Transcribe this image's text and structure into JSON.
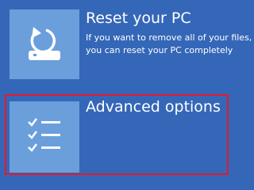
{
  "screen": {
    "background_color": "#3567b8",
    "selection_border_color": "#e11a2b",
    "icon_tile_color": "#6a9fdc"
  },
  "options": [
    {
      "id": "reset",
      "title": "Reset your PC",
      "description_lines": [
        "If you want to remove all of your files,",
        "you can reset your PC completely"
      ],
      "icon": "reset-pc-icon"
    },
    {
      "id": "advanced",
      "title": "Advanced options",
      "icon": "checklist-icon",
      "selected": true
    }
  ]
}
